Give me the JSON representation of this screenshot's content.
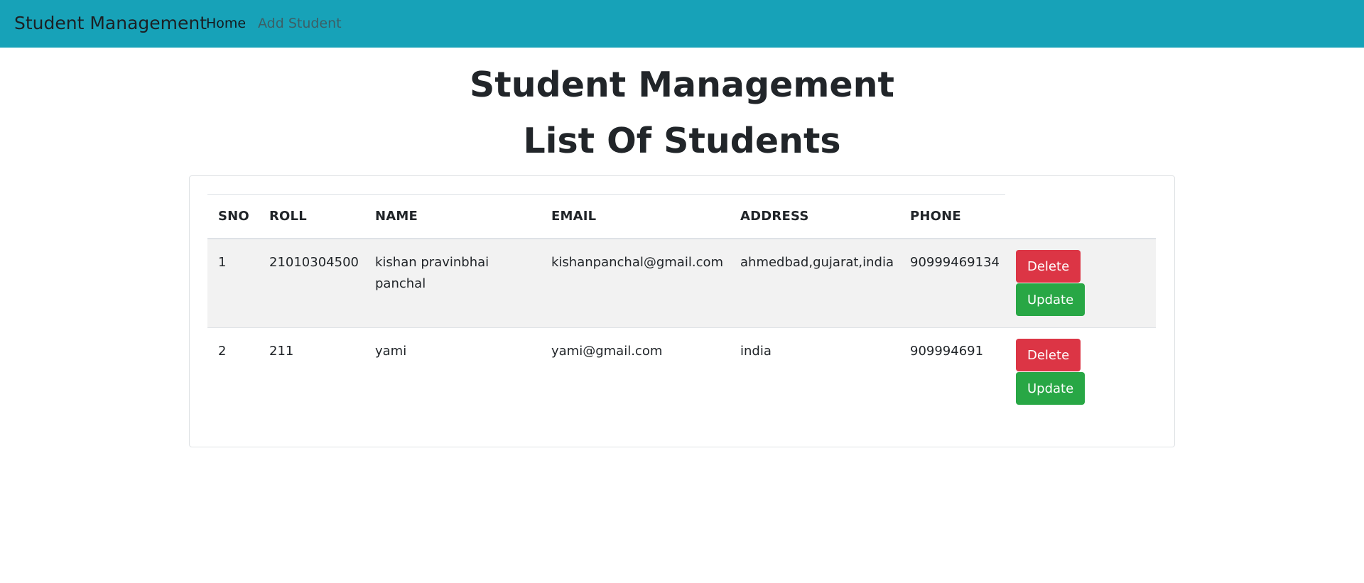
{
  "navbar": {
    "brand": "Student Management",
    "links": [
      {
        "label": "Home"
      },
      {
        "label": "Add Student"
      }
    ]
  },
  "main": {
    "title": "Student Management",
    "subtitle": "List Of Students"
  },
  "table": {
    "headers": [
      "SNO",
      "ROLL",
      "NAME",
      "EMAIL",
      "ADDRESS",
      "PHONE"
    ],
    "rows": [
      {
        "sno": "1",
        "roll": "21010304500",
        "name": "kishan pravinbhai panchal",
        "email": "kishanpanchal@gmail.com",
        "address": "ahmedbad,gujarat,india",
        "phone": "90999469134"
      },
      {
        "sno": "2",
        "roll": "211",
        "name": "yami",
        "email": "yami@gmail.com",
        "address": "india",
        "phone": "909994691"
      }
    ],
    "actions": {
      "delete_label": "Delete",
      "update_label": "Update"
    }
  },
  "colors": {
    "navbar": "#17a2b8",
    "delete": "#dc3545",
    "update": "#28a745"
  }
}
